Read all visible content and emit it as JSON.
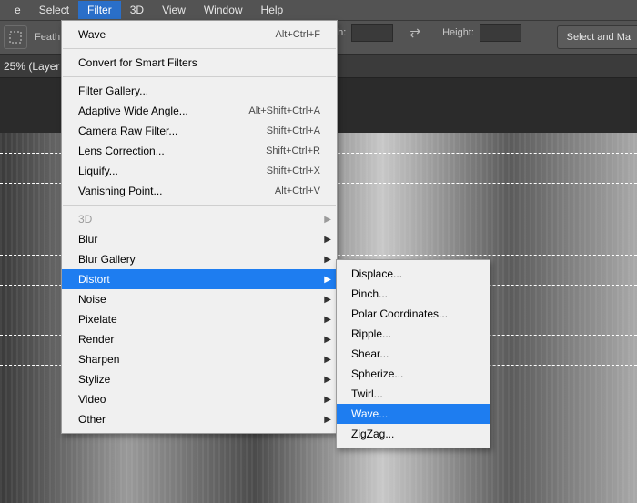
{
  "menubar": {
    "items": [
      "e",
      "Select",
      "Filter",
      "3D",
      "View",
      "Window",
      "Help"
    ],
    "active_index": 2
  },
  "optionsbar": {
    "feather_label": "Feath",
    "width_label": "dth:",
    "height_label": "Height:",
    "select_mask_label": "Select and Ma"
  },
  "doctab": {
    "text": "25% (Layer"
  },
  "dropdown": {
    "top": {
      "label": "Wave",
      "shortcut": "Alt+Ctrl+F"
    },
    "convert": "Convert for Smart Filters",
    "group2": [
      {
        "label": "Filter Gallery...",
        "shortcut": ""
      },
      {
        "label": "Adaptive Wide Angle...",
        "shortcut": "Alt+Shift+Ctrl+A"
      },
      {
        "label": "Camera Raw Filter...",
        "shortcut": "Shift+Ctrl+A"
      },
      {
        "label": "Lens Correction...",
        "shortcut": "Shift+Ctrl+R"
      },
      {
        "label": "Liquify...",
        "shortcut": "Shift+Ctrl+X"
      },
      {
        "label": "Vanishing Point...",
        "shortcut": "Alt+Ctrl+V"
      }
    ],
    "group3": [
      {
        "label": "3D",
        "disabled": true
      },
      {
        "label": "Blur"
      },
      {
        "label": "Blur Gallery"
      },
      {
        "label": "Distort",
        "highlight": true
      },
      {
        "label": "Noise"
      },
      {
        "label": "Pixelate"
      },
      {
        "label": "Render"
      },
      {
        "label": "Sharpen"
      },
      {
        "label": "Stylize"
      },
      {
        "label": "Video"
      },
      {
        "label": "Other"
      }
    ]
  },
  "submenu": {
    "items": [
      "Displace...",
      "Pinch...",
      "Polar Coordinates...",
      "Ripple...",
      "Shear...",
      "Spherize...",
      "Twirl...",
      "Wave...",
      "ZigZag..."
    ],
    "highlight_index": 7
  }
}
